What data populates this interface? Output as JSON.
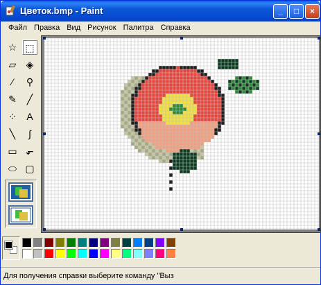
{
  "window": {
    "title": "Цветок.bmp - Paint",
    "minimize_label": "_",
    "maximize_label": "□",
    "close_label": "×"
  },
  "menu": {
    "items": [
      {
        "label": "Файл"
      },
      {
        "label": "Правка"
      },
      {
        "label": "Вид"
      },
      {
        "label": "Рисунок"
      },
      {
        "label": "Палитра"
      },
      {
        "label": "Справка"
      }
    ]
  },
  "tools": [
    {
      "name": "free-form-select-icon",
      "glyph": "☆"
    },
    {
      "name": "rect-select-icon",
      "glyph": "⬚",
      "selected": true
    },
    {
      "name": "eraser-icon",
      "glyph": "▱"
    },
    {
      "name": "fill-bucket-icon",
      "glyph": "◈"
    },
    {
      "name": "color-picker-icon",
      "glyph": "⁄"
    },
    {
      "name": "magnifier-icon",
      "glyph": "⚲"
    },
    {
      "name": "pencil-icon",
      "glyph": "✎"
    },
    {
      "name": "brush-icon",
      "glyph": "╱"
    },
    {
      "name": "airbrush-icon",
      "glyph": "⁘"
    },
    {
      "name": "text-icon",
      "glyph": "A"
    },
    {
      "name": "line-icon",
      "glyph": "╲"
    },
    {
      "name": "curve-icon",
      "glyph": "∫"
    },
    {
      "name": "rectangle-icon",
      "glyph": "▭"
    },
    {
      "name": "polygon-icon",
      "glyph": "⬐"
    },
    {
      "name": "ellipse-icon",
      "glyph": "⬭"
    },
    {
      "name": "rounded-rect-icon",
      "glyph": "▢"
    }
  ],
  "palette": {
    "foreground": "#000000",
    "background": "#ffffff",
    "colors_row1": [
      "#000000",
      "#808080",
      "#800000",
      "#808000",
      "#008000",
      "#008080",
      "#000080",
      "#800080",
      "#808040",
      "#004040",
      "#0080ff",
      "#004080",
      "#8000ff",
      "#804000"
    ],
    "colors_row2": [
      "#ffffff",
      "#c0c0c0",
      "#ff0000",
      "#ffff00",
      "#00ff00",
      "#00ffff",
      "#0000ff",
      "#ff00ff",
      "#ffff80",
      "#00ff80",
      "#80ffff",
      "#8080ff",
      "#ff0080",
      "#ff8040"
    ]
  },
  "status": {
    "text": "Для получения справки выберите команду \"Выз"
  },
  "colors": {
    "title_bar": "#0b58d8",
    "canvas_bg": "#ffffff",
    "grid": "#c0c0c0",
    "petal_red": "#e8463c",
    "petal_light": "#f0a080",
    "center_yellow": "#f0e040",
    "leaf_dark": "#0c3c20",
    "leaf_green": "#2e8b3a",
    "shadow_olive": "#a6a880",
    "pixel_black": "#202020"
  }
}
